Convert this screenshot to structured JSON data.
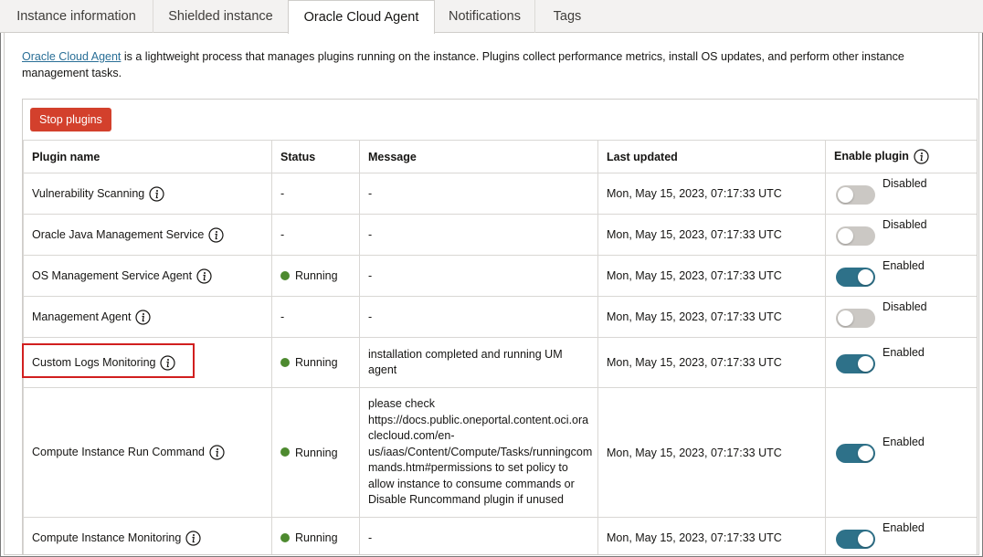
{
  "tabs": [
    {
      "label": "Instance information",
      "active": false
    },
    {
      "label": "Shielded instance",
      "active": false
    },
    {
      "label": "Oracle Cloud Agent",
      "active": true
    },
    {
      "label": "Notifications",
      "active": false
    },
    {
      "label": "Tags",
      "active": false
    }
  ],
  "description": {
    "link_text": "Oracle Cloud Agent",
    "text": " is a lightweight process that manages plugins running on the instance. Plugins collect performance metrics, install OS updates, and perform other instance management tasks."
  },
  "toolbar": {
    "stop_label": "Stop plugins"
  },
  "table": {
    "headers": [
      "Plugin name",
      "Status",
      "Message",
      "Last updated",
      "Enable plugin"
    ],
    "rows": [
      {
        "name": "Vulnerability Scanning",
        "status": "-",
        "running": false,
        "message": "-",
        "updated": "Mon, May 15, 2023, 07:17:33 UTC",
        "enabled": false,
        "enable_label": "Disabled"
      },
      {
        "name": "Oracle Java Management Service",
        "status": "-",
        "running": false,
        "message": "-",
        "updated": "Mon, May 15, 2023, 07:17:33 UTC",
        "enabled": false,
        "enable_label": "Disabled"
      },
      {
        "name": "OS Management Service Agent",
        "status": "Running",
        "running": true,
        "message": "-",
        "updated": "Mon, May 15, 2023, 07:17:33 UTC",
        "enabled": true,
        "enable_label": "Enabled"
      },
      {
        "name": "Management Agent",
        "status": "-",
        "running": false,
        "message": "-",
        "updated": "Mon, May 15, 2023, 07:17:33 UTC",
        "enabled": false,
        "enable_label": "Disabled"
      },
      {
        "name": "Custom Logs Monitoring",
        "status": "Running",
        "running": true,
        "message_lines": [
          "installation completed and running UM",
          "agent"
        ],
        "updated": "Mon, May 15, 2023, 07:17:33 UTC",
        "enabled": true,
        "enable_label": "Enabled"
      },
      {
        "name": "Compute Instance Run Command",
        "status": "Running",
        "running": true,
        "message_lines": [
          "please check",
          "https://docs.public.oneportal.content.oci.ora",
          "clecloud.com/en-",
          "us/iaas/Content/Compute/Tasks/runningcom",
          "mands.htm#permissions to set policy to",
          "allow instance to consume commands or",
          "Disable Runcommand plugin if unused"
        ],
        "updated": "Mon, May 15, 2023, 07:17:33 UTC",
        "enabled": true,
        "enable_label": "Enabled"
      },
      {
        "name": "Compute Instance Monitoring",
        "status": "Running",
        "running": true,
        "message": "-",
        "updated": "Mon, May 15, 2023, 07:17:33 UTC",
        "enabled": true,
        "enable_label": "Enabled"
      }
    ]
  },
  "colors": {
    "accent_toggle_on": "#2e7189",
    "toggle_off": "#cbc8c4",
    "running_dot": "#4d8a2f",
    "stop_button": "#d3402c",
    "highlight_border": "#d11f1f",
    "link": "#2a6f97"
  },
  "icons": {
    "info": "info-circle-icon"
  }
}
